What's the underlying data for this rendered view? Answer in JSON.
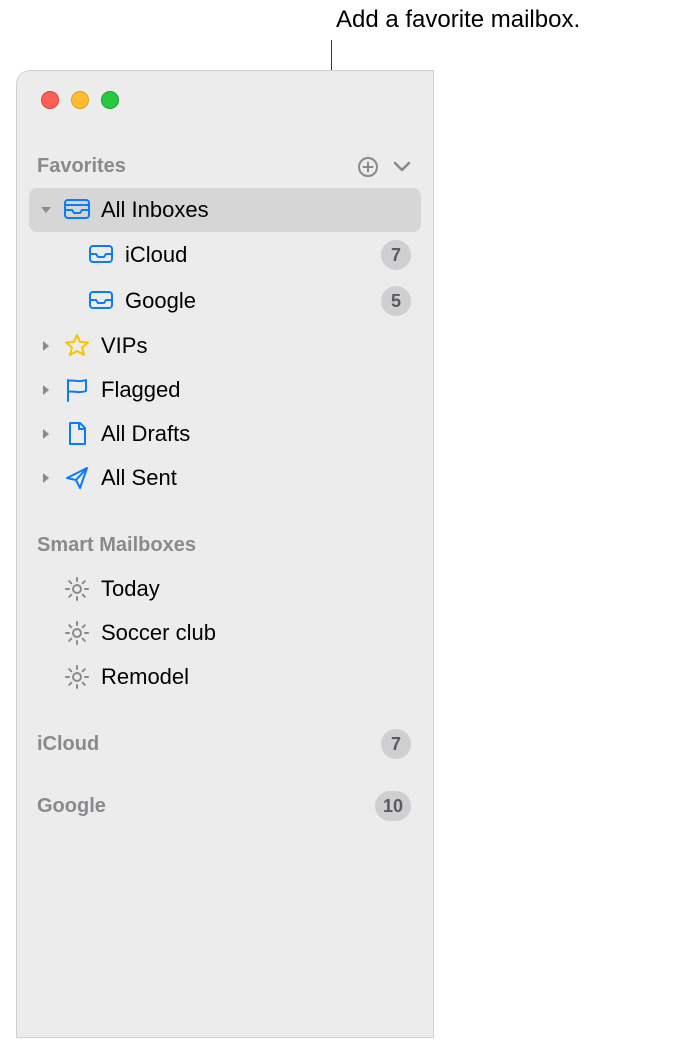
{
  "annotation": "Add a favorite mailbox.",
  "sections": {
    "favorites": {
      "title": "Favorites",
      "items": [
        {
          "label": "All Inboxes"
        },
        {
          "label": "iCloud",
          "badge": "7"
        },
        {
          "label": "Google",
          "badge": "5"
        },
        {
          "label": "VIPs"
        },
        {
          "label": "Flagged"
        },
        {
          "label": "All Drafts"
        },
        {
          "label": "All Sent"
        }
      ]
    },
    "smart": {
      "title": "Smart Mailboxes",
      "items": [
        {
          "label": "Today"
        },
        {
          "label": "Soccer club"
        },
        {
          "label": "Remodel"
        }
      ]
    },
    "accounts": [
      {
        "label": "iCloud",
        "badge": "7"
      },
      {
        "label": "Google",
        "badge": "10"
      }
    ]
  }
}
